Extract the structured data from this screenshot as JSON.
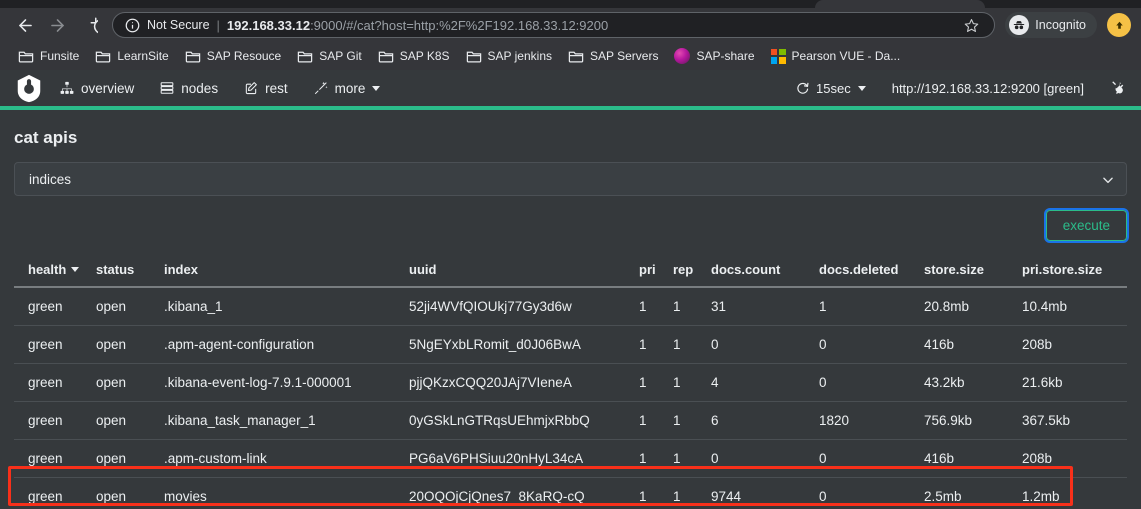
{
  "browser": {
    "back_label": "Back",
    "forward_label": "Forward",
    "reload_label": "Reload",
    "security_label": "Not Secure",
    "separator": "|",
    "url_host": "192.168.33.12",
    "url_rest": ":9000/#/cat?host=http:%2F%2F192.168.33.12:9200",
    "bookmark_star_label": "Bookmark this tab",
    "incognito_label": "Incognito",
    "bookmarks": [
      {
        "label": "Funsite",
        "icon": "folder-icon"
      },
      {
        "label": "LearnSite",
        "icon": "folder-icon"
      },
      {
        "label": "SAP Resouce",
        "icon": "folder-icon"
      },
      {
        "label": "SAP Git",
        "icon": "folder-icon"
      },
      {
        "label": "SAP K8S",
        "icon": "folder-icon"
      },
      {
        "label": "SAP jenkins",
        "icon": "folder-icon"
      },
      {
        "label": "SAP Servers",
        "icon": "folder-icon"
      },
      {
        "label": "SAP-share",
        "icon": "sap-share-icon"
      },
      {
        "label": "Pearson VUE - Da...",
        "icon": "microsoft-icon"
      }
    ]
  },
  "app": {
    "logo_name": "cerebro-logo",
    "nav": [
      {
        "label": "overview",
        "icon": "sitemap-icon"
      },
      {
        "label": "nodes",
        "icon": "server-icon"
      },
      {
        "label": "rest",
        "icon": "edit-icon"
      },
      {
        "label": "more",
        "icon": "magic-icon"
      }
    ],
    "refresh_interval": "15sec",
    "cluster": "http://192.168.33.12:9200 [green]",
    "accent_color": "#2bbc8a"
  },
  "main": {
    "title": "cat apis",
    "selected_api": "indices",
    "api_options": [
      "indices"
    ],
    "execute_label": "execute"
  },
  "table": {
    "columns": [
      {
        "label": "health",
        "sorted": true
      },
      {
        "label": "status",
        "sorted": false
      },
      {
        "label": "index",
        "sorted": false
      },
      {
        "label": "uuid",
        "sorted": false
      },
      {
        "label": "pri",
        "sorted": false
      },
      {
        "label": "rep",
        "sorted": false
      },
      {
        "label": "docs.count",
        "sorted": false
      },
      {
        "label": "docs.deleted",
        "sorted": false
      },
      {
        "label": "store.size",
        "sorted": false
      },
      {
        "label": "pri.store.size",
        "sorted": false
      }
    ],
    "rows": [
      {
        "health": "green",
        "status": "open",
        "index": ".kibana_1",
        "uuid": "52ji4WVfQIOUkj77Gy3d6w",
        "pri": "1",
        "rep": "1",
        "docs_count": "31",
        "docs_deleted": "1",
        "store_size": "20.8mb",
        "pri_store_size": "10.4mb",
        "highlighted": false
      },
      {
        "health": "green",
        "status": "open",
        "index": ".apm-agent-configuration",
        "uuid": "5NgEYxbLRomit_d0J06BwA",
        "pri": "1",
        "rep": "1",
        "docs_count": "0",
        "docs_deleted": "0",
        "store_size": "416b",
        "pri_store_size": "208b",
        "highlighted": false
      },
      {
        "health": "green",
        "status": "open",
        "index": ".kibana-event-log-7.9.1-000001",
        "uuid": "pjjQKzxCQQ20JAj7VIeneA",
        "pri": "1",
        "rep": "1",
        "docs_count": "4",
        "docs_deleted": "0",
        "store_size": "43.2kb",
        "pri_store_size": "21.6kb",
        "highlighted": false
      },
      {
        "health": "green",
        "status": "open",
        "index": ".kibana_task_manager_1",
        "uuid": "0yGSkLnGTRqsUEhmjxRbbQ",
        "pri": "1",
        "rep": "1",
        "docs_count": "6",
        "docs_deleted": "1820",
        "store_size": "756.9kb",
        "pri_store_size": "367.5kb",
        "highlighted": false
      },
      {
        "health": "green",
        "status": "open",
        "index": ".apm-custom-link",
        "uuid": "PG6aV6PHSiuu20nHyL34cA",
        "pri": "1",
        "rep": "1",
        "docs_count": "0",
        "docs_deleted": "0",
        "store_size": "416b",
        "pri_store_size": "208b",
        "highlighted": false
      },
      {
        "health": "green",
        "status": "open",
        "index": "movies",
        "uuid": "20OQOjCjQnes7_8KaRQ-cQ",
        "pri": "1",
        "rep": "1",
        "docs_count": "9744",
        "docs_deleted": "0",
        "store_size": "2.5mb",
        "pri_store_size": "1.2mb",
        "highlighted": true
      }
    ],
    "highlight_color": "#f8301a"
  }
}
